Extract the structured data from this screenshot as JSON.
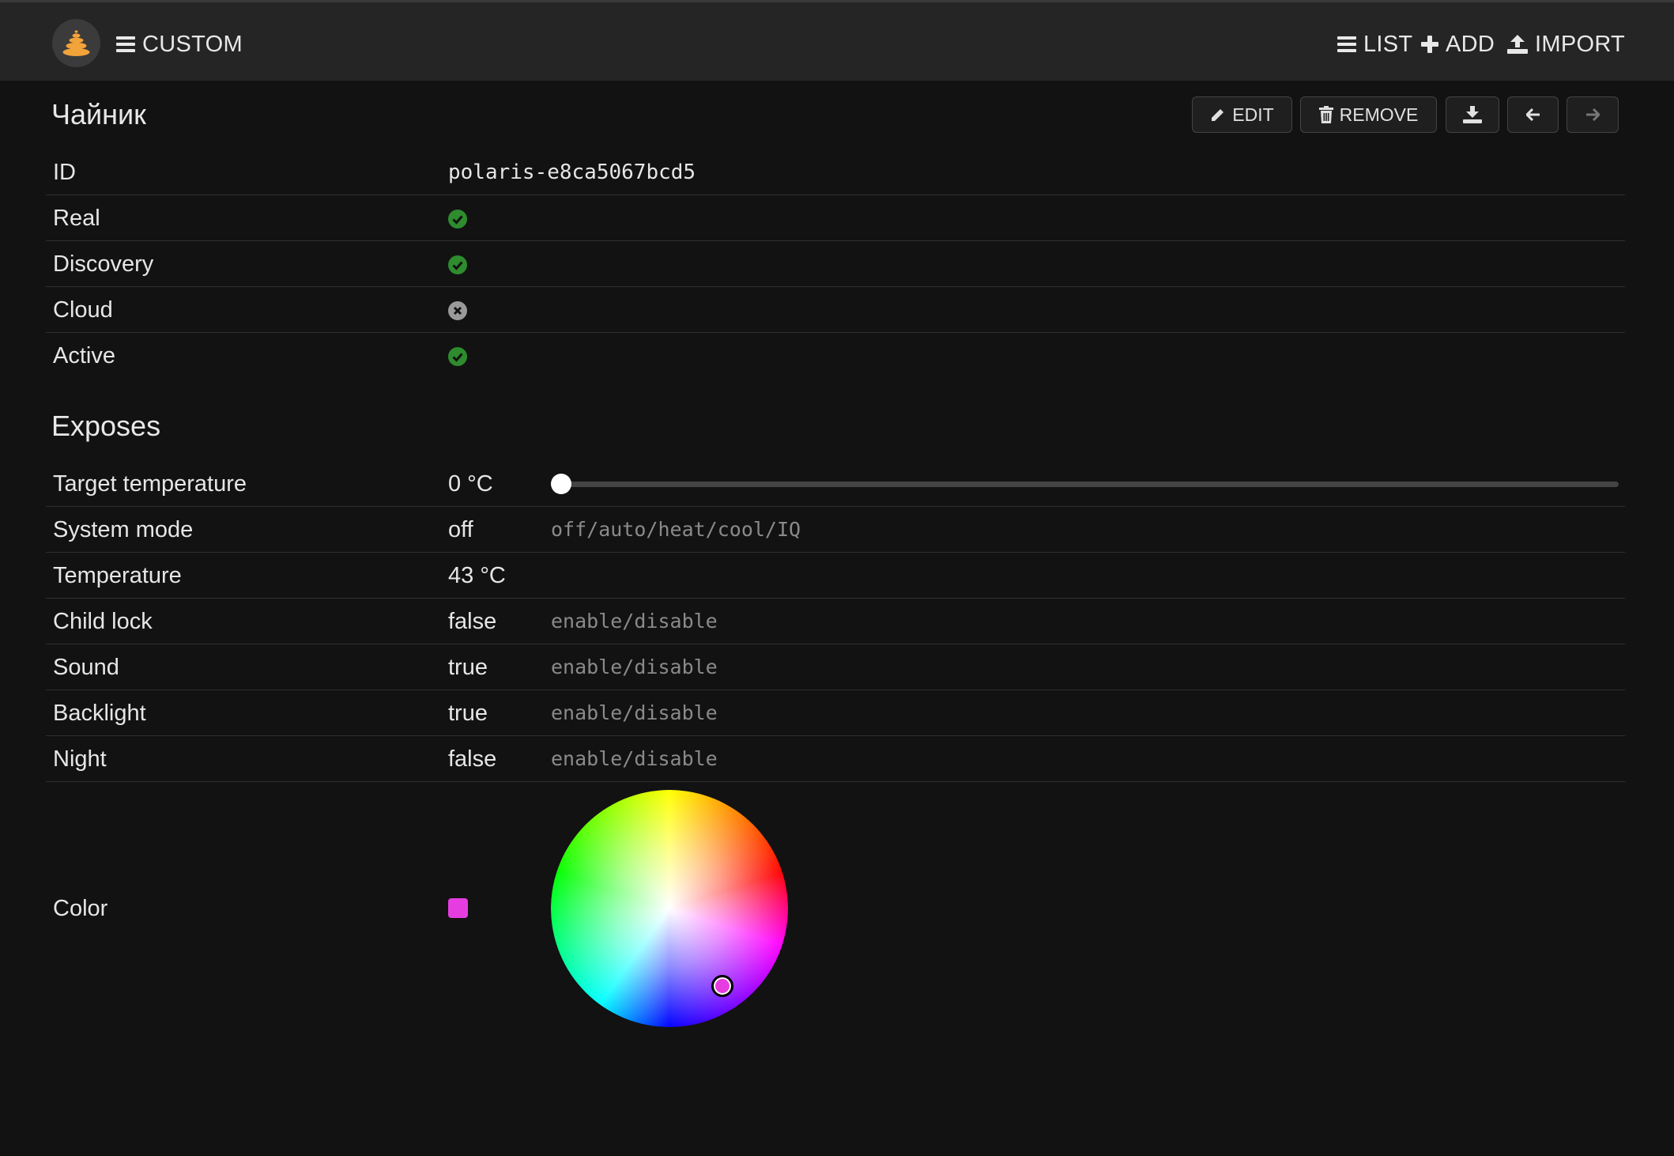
{
  "navbar": {
    "title": "CUSTOM",
    "list_label": "LIST",
    "add_label": "ADD",
    "import_label": "IMPORT"
  },
  "device": {
    "title": "Чайник",
    "buttons": {
      "edit": "EDIT",
      "remove": "REMOVE"
    }
  },
  "info": [
    {
      "label": "ID",
      "value": "polaris-e8ca5067bcd5"
    },
    {
      "label": "Real",
      "status": "ok"
    },
    {
      "label": "Discovery",
      "status": "ok"
    },
    {
      "label": "Cloud",
      "status": "off"
    },
    {
      "label": "Active",
      "status": "ok"
    }
  ],
  "exposes": {
    "title": "Exposes",
    "rows": [
      {
        "label": "Target temperature",
        "value": "0 °C",
        "slider_fraction": 0
      },
      {
        "label": "System mode",
        "value": "off",
        "hint": "off/auto/heat/cool/IQ"
      },
      {
        "label": "Temperature",
        "value": "43 °C"
      },
      {
        "label": "Child lock",
        "value": "false",
        "hint": "enable/disable"
      },
      {
        "label": "Sound",
        "value": "true",
        "hint": "enable/disable"
      },
      {
        "label": "Backlight",
        "value": "true",
        "hint": "enable/disable"
      },
      {
        "label": "Night",
        "value": "false",
        "hint": "enable/disable"
      }
    ],
    "color": {
      "label": "Color",
      "value": "#e53de0"
    }
  },
  "colors": {
    "ok": "#2e8b2e",
    "off": "#9a9a9a",
    "accent": "#f2a33a"
  }
}
